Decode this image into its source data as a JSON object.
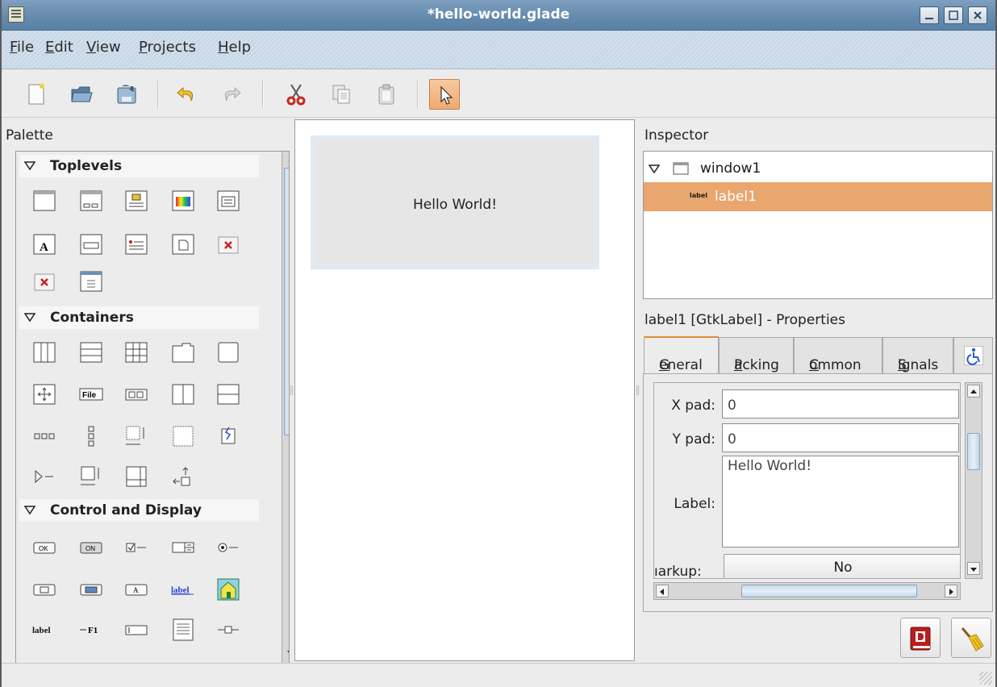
{
  "window": {
    "title": "*hello-world.glade"
  },
  "menu": {
    "items": [
      {
        "first": "F",
        "rest": "ile"
      },
      {
        "first": "E",
        "rest": "dit"
      },
      {
        "first": "V",
        "rest": "iew"
      },
      {
        "first": "P",
        "rest": "rojects"
      },
      {
        "first": "H",
        "rest": "elp"
      }
    ]
  },
  "toolbar": {
    "icons": [
      "new-document-icon",
      "open-folder-icon",
      "save-icon",
      "undo-icon",
      "redo-icon",
      "cut-icon",
      "copy-icon",
      "paste-icon",
      "selector-pointer-icon"
    ],
    "active_tool": "selector-pointer-icon"
  },
  "palette": {
    "title": "Palette",
    "groups": [
      {
        "name": "Toplevels"
      },
      {
        "name": "Containers"
      },
      {
        "name": "Control and Display"
      }
    ],
    "glyphs": {
      "file": "File",
      "ok": "OK",
      "on": "ON",
      "label_blue": "label",
      "label_black": "label",
      "f1": "F1",
      "a": "A"
    }
  },
  "canvas": {
    "label_text": "Hello World!"
  },
  "inspector": {
    "title": "Inspector",
    "tree": [
      {
        "label": "window1",
        "type_icon": "window-icon"
      },
      {
        "badge": "label",
        "label": "label1",
        "selected": true
      }
    ]
  },
  "properties": {
    "title": "label1 [GtkLabel] - Properties",
    "tabs": [
      {
        "first": "G",
        "rest": "eneral",
        "active": true
      },
      {
        "first": "P",
        "rest": "acking"
      },
      {
        "first": "C",
        "rest": "ommon"
      },
      {
        "first": "S",
        "rest": "ignals"
      }
    ],
    "fields": {
      "xpad_label": "X pad:",
      "xpad_value": "0",
      "ypad_label": "Y pad:",
      "ypad_value": "0",
      "label_label": "Label:",
      "label_value": "Hello World!",
      "markup_label": "ıarkup:",
      "markup_value": "No"
    }
  },
  "colors": {
    "selection": "#e9a66e",
    "titlebar": "#6389ad",
    "menubar": "#c6d6e6"
  }
}
